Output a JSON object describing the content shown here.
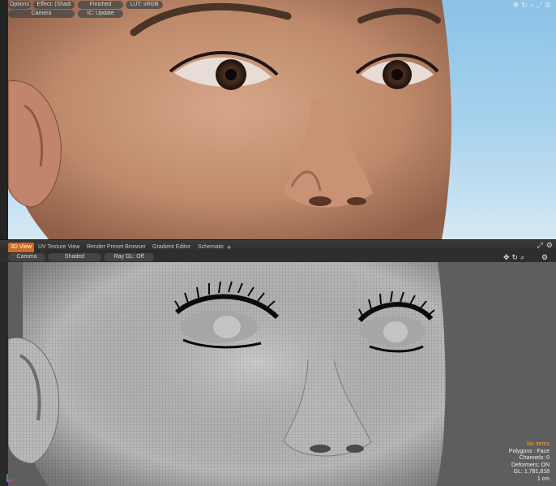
{
  "render_view": {
    "toolbar": {
      "options_label": "Options",
      "effect_label": "Effect: (Shadi",
      "finished_label": "Finished",
      "lut_label": "LUT: sRGB",
      "camera_label": "Camera",
      "ic_label": "IC: Update"
    },
    "nav_icons": [
      "move-icon",
      "rotate-icon",
      "zoom-icon",
      "maximize-icon",
      "settings-icon"
    ]
  },
  "tabs": [
    {
      "label": "3D View",
      "active": true
    },
    {
      "label": "UV Texture View",
      "active": false
    },
    {
      "label": "Render Preset Browser",
      "active": false
    },
    {
      "label": "Gradient Editor",
      "active": false
    },
    {
      "label": "Schematic",
      "active": false
    },
    {
      "label": "+",
      "active": false
    }
  ],
  "viewport": {
    "toolbar": {
      "camera_label": "Camera",
      "shaded_label": "Shaded",
      "raygl_label": "Ray GL: Off"
    },
    "info": {
      "selection": "No Items",
      "polygons": "Polygons : Face",
      "channels": "Channels: 0",
      "deformers": "Deformers: ON",
      "gl": "GL: 1,781,818",
      "scale": "1 cm"
    }
  },
  "colors": {
    "accent": "#d2691e",
    "info_highlight": "#f5a623",
    "panel_bg": "#2e2e2e"
  }
}
